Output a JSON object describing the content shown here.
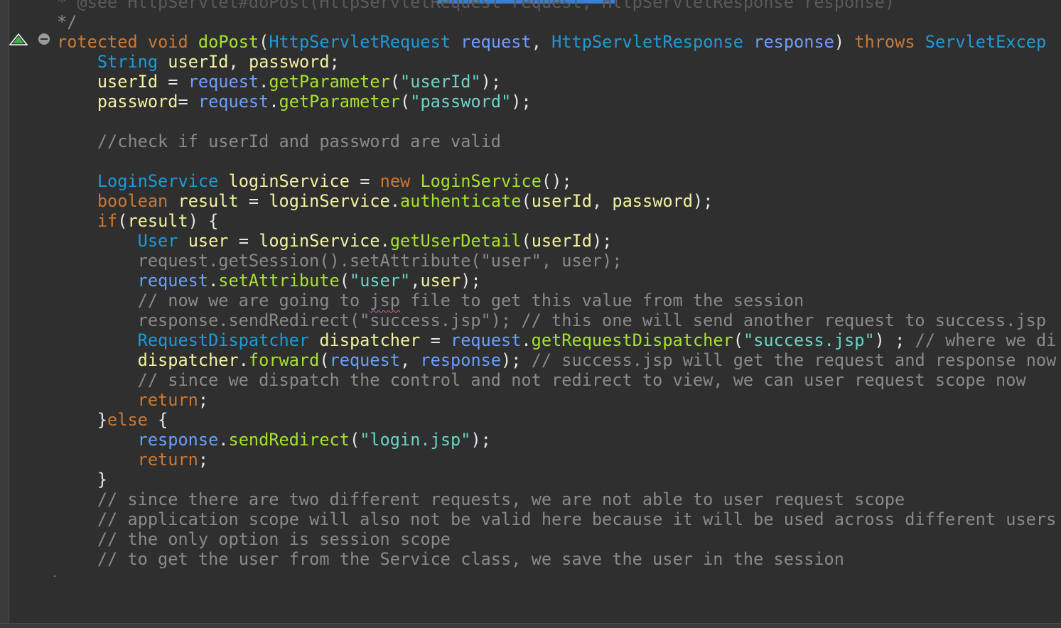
{
  "editor": {
    "language": "java",
    "lines": [
      {
        "indent": "",
        "tokens": [
          {
            "t": "* @see HttpServlet#doPost(HttpServletRequest request, HttpServletResponse response)",
            "c": "faded"
          }
        ]
      },
      {
        "indent": "",
        "tokens": [
          {
            "t": "*/",
            "c": "comment"
          }
        ]
      },
      {
        "indent": "",
        "tokens": [
          {
            "t": "rotected",
            "c": "kw"
          },
          {
            "t": " ",
            "c": "plain"
          },
          {
            "t": "void",
            "c": "kw"
          },
          {
            "t": " ",
            "c": "plain"
          },
          {
            "t": "doPost",
            "c": "method"
          },
          {
            "t": "(",
            "c": "plain"
          },
          {
            "t": "HttpServletRequest",
            "c": "type"
          },
          {
            "t": " ",
            "c": "plain"
          },
          {
            "t": "request",
            "c": "field"
          },
          {
            "t": ", ",
            "c": "plain"
          },
          {
            "t": "HttpServletResponse",
            "c": "type"
          },
          {
            "t": " ",
            "c": "plain"
          },
          {
            "t": "response",
            "c": "field"
          },
          {
            "t": ") ",
            "c": "plain"
          },
          {
            "t": "throws",
            "c": "kw"
          },
          {
            "t": " ",
            "c": "plain"
          },
          {
            "t": "ServletExcep",
            "c": "type"
          }
        ]
      },
      {
        "indent": "    ",
        "tokens": [
          {
            "t": "String",
            "c": "type"
          },
          {
            "t": " ",
            "c": "plain"
          },
          {
            "t": "userId",
            "c": "var"
          },
          {
            "t": ", ",
            "c": "plain"
          },
          {
            "t": "password",
            "c": "var"
          },
          {
            "t": ";",
            "c": "plain"
          }
        ]
      },
      {
        "indent": "    ",
        "tokens": [
          {
            "t": "userId",
            "c": "var"
          },
          {
            "t": " = ",
            "c": "plain"
          },
          {
            "t": "request",
            "c": "field"
          },
          {
            "t": ".",
            "c": "plain"
          },
          {
            "t": "getParameter",
            "c": "method"
          },
          {
            "t": "(",
            "c": "plain"
          },
          {
            "t": "\"userId\"",
            "c": "str"
          },
          {
            "t": ");",
            "c": "plain"
          }
        ]
      },
      {
        "indent": "    ",
        "tokens": [
          {
            "t": "password",
            "c": "var"
          },
          {
            "t": "= ",
            "c": "plain"
          },
          {
            "t": "request",
            "c": "field"
          },
          {
            "t": ".",
            "c": "plain"
          },
          {
            "t": "getParameter",
            "c": "method"
          },
          {
            "t": "(",
            "c": "plain"
          },
          {
            "t": "\"password\"",
            "c": "str"
          },
          {
            "t": ");",
            "c": "plain"
          }
        ]
      },
      {
        "indent": "",
        "tokens": []
      },
      {
        "indent": "    ",
        "tokens": [
          {
            "t": "//check if userId and password are valid",
            "c": "comment"
          }
        ]
      },
      {
        "indent": "",
        "tokens": []
      },
      {
        "indent": "    ",
        "tokens": [
          {
            "t": "LoginService",
            "c": "type"
          },
          {
            "t": " ",
            "c": "plain"
          },
          {
            "t": "loginService",
            "c": "var"
          },
          {
            "t": " = ",
            "c": "plain"
          },
          {
            "t": "new",
            "c": "kw"
          },
          {
            "t": " ",
            "c": "plain"
          },
          {
            "t": "LoginService",
            "c": "method"
          },
          {
            "t": "();",
            "c": "plain"
          }
        ]
      },
      {
        "indent": "    ",
        "tokens": [
          {
            "t": "boolean",
            "c": "kw"
          },
          {
            "t": " ",
            "c": "plain"
          },
          {
            "t": "result",
            "c": "var"
          },
          {
            "t": " = ",
            "c": "plain"
          },
          {
            "t": "loginService",
            "c": "var"
          },
          {
            "t": ".",
            "c": "plain"
          },
          {
            "t": "authenticate",
            "c": "method"
          },
          {
            "t": "(",
            "c": "plain"
          },
          {
            "t": "userId",
            "c": "var"
          },
          {
            "t": ", ",
            "c": "plain"
          },
          {
            "t": "password",
            "c": "var"
          },
          {
            "t": ");",
            "c": "plain"
          }
        ]
      },
      {
        "indent": "    ",
        "tokens": [
          {
            "t": "if",
            "c": "kw"
          },
          {
            "t": "(",
            "c": "plain"
          },
          {
            "t": "result",
            "c": "var"
          },
          {
            "t": ") {",
            "c": "plain"
          }
        ]
      },
      {
        "indent": "        ",
        "tokens": [
          {
            "t": "User",
            "c": "type"
          },
          {
            "t": " ",
            "c": "plain"
          },
          {
            "t": "user",
            "c": "var"
          },
          {
            "t": " = ",
            "c": "plain"
          },
          {
            "t": "loginService",
            "c": "var"
          },
          {
            "t": ".",
            "c": "plain"
          },
          {
            "t": "getUserDetail",
            "c": "method"
          },
          {
            "t": "(",
            "c": "plain"
          },
          {
            "t": "userId",
            "c": "var"
          },
          {
            "t": ");",
            "c": "plain"
          }
        ]
      },
      {
        "indent": "        ",
        "tokens": [
          {
            "t": "request.getSession().setAttribute(\"user\", user);",
            "c": "comment"
          }
        ]
      },
      {
        "indent": "        ",
        "tokens": [
          {
            "t": "request",
            "c": "field"
          },
          {
            "t": ".",
            "c": "plain"
          },
          {
            "t": "setAttribute",
            "c": "method"
          },
          {
            "t": "(",
            "c": "plain"
          },
          {
            "t": "\"user\"",
            "c": "str"
          },
          {
            "t": ",",
            "c": "plain"
          },
          {
            "t": "user",
            "c": "var"
          },
          {
            "t": ");",
            "c": "plain"
          }
        ]
      },
      {
        "indent": "        ",
        "tokens": [
          {
            "t": "// now we are going to ",
            "c": "comment"
          },
          {
            "t": "jsp",
            "c": "comment",
            "squiggle": true
          },
          {
            "t": " file to get this value from the session",
            "c": "comment"
          }
        ]
      },
      {
        "indent": "        ",
        "tokens": [
          {
            "t": "response.sendRedirect(\"success.jsp\"); // this one will send another request to success.jsp",
            "c": "comment"
          }
        ]
      },
      {
        "indent": "        ",
        "tokens": [
          {
            "t": "RequestDispatcher",
            "c": "type"
          },
          {
            "t": " ",
            "c": "plain"
          },
          {
            "t": "dispatcher",
            "c": "var"
          },
          {
            "t": " = ",
            "c": "plain"
          },
          {
            "t": "request",
            "c": "field"
          },
          {
            "t": ".",
            "c": "plain"
          },
          {
            "t": "getRequestDispatcher",
            "c": "method"
          },
          {
            "t": "(",
            "c": "plain"
          },
          {
            "t": "\"success.jsp\"",
            "c": "str"
          },
          {
            "t": ") ; ",
            "c": "plain"
          },
          {
            "t": "// where we di",
            "c": "comment"
          }
        ]
      },
      {
        "indent": "        ",
        "tokens": [
          {
            "t": "dispatcher",
            "c": "var"
          },
          {
            "t": ".",
            "c": "plain"
          },
          {
            "t": "forward",
            "c": "method"
          },
          {
            "t": "(",
            "c": "plain"
          },
          {
            "t": "request",
            "c": "field"
          },
          {
            "t": ", ",
            "c": "plain"
          },
          {
            "t": "response",
            "c": "field"
          },
          {
            "t": "); ",
            "c": "plain"
          },
          {
            "t": "// success.jsp will get the request and response now",
            "c": "comment"
          }
        ]
      },
      {
        "indent": "        ",
        "tokens": [
          {
            "t": "// since we dispatch the control and not redirect to view, we can user request scope now",
            "c": "comment"
          }
        ]
      },
      {
        "indent": "        ",
        "tokens": [
          {
            "t": "return",
            "c": "kw"
          },
          {
            "t": ";",
            "c": "plain"
          }
        ]
      },
      {
        "indent": "    ",
        "tokens": [
          {
            "t": "}",
            "c": "plain"
          },
          {
            "t": "else",
            "c": "kw"
          },
          {
            "t": " {",
            "c": "plain"
          }
        ]
      },
      {
        "indent": "        ",
        "tokens": [
          {
            "t": "response",
            "c": "field"
          },
          {
            "t": ".",
            "c": "plain"
          },
          {
            "t": "sendRedirect",
            "c": "method"
          },
          {
            "t": "(",
            "c": "plain"
          },
          {
            "t": "\"login.jsp\"",
            "c": "str"
          },
          {
            "t": ");",
            "c": "plain"
          }
        ]
      },
      {
        "indent": "        ",
        "tokens": [
          {
            "t": "return",
            "c": "kw"
          },
          {
            "t": ";",
            "c": "plain"
          }
        ]
      },
      {
        "indent": "    ",
        "tokens": [
          {
            "t": "}",
            "c": "plain"
          }
        ]
      },
      {
        "indent": "    ",
        "tokens": [
          {
            "t": "// since there are two different requests, we are not able to user request scope",
            "c": "comment"
          }
        ]
      },
      {
        "indent": "    ",
        "tokens": [
          {
            "t": "// application scope will also not be valid here because it will be used across different users",
            "c": "comment"
          }
        ]
      },
      {
        "indent": "    ",
        "tokens": [
          {
            "t": "// the only option is session scope",
            "c": "comment"
          }
        ]
      },
      {
        "indent": "    ",
        "tokens": [
          {
            "t": "// to get the user from the Service class, we save the user in the session",
            "c": "comment"
          }
        ]
      }
    ]
  },
  "gutter": {
    "warning_icon": "override-triangle-icon",
    "collapse_icon": "fold-collapse-icon"
  },
  "colors": {
    "background": "#2f2f2f",
    "keyword": "#cc7832",
    "type": "#1e9ad6",
    "method": "#a6e22e",
    "string": "#6ad4c6",
    "variable": "#f2f2a0",
    "field": "#6b9eff",
    "comment": "#8a8a8a",
    "selection_bar": "#3a7fd6",
    "warning_green": "#3cb043"
  }
}
